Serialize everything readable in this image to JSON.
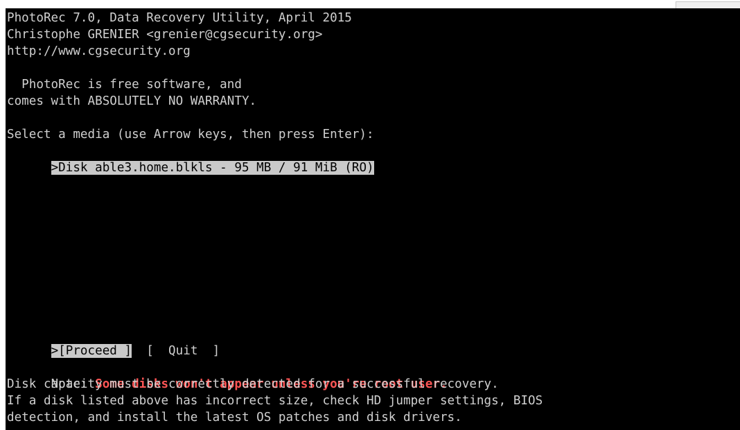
{
  "header": {
    "line1": "PhotoRec 7.0, Data Recovery Utility, April 2015",
    "line2": "Christophe GRENIER <grenier@cgsecurity.org>",
    "line3": "http://www.cgsecurity.org"
  },
  "license": {
    "line1": "  PhotoRec is free software, and",
    "line2": "comes with ABSOLUTELY NO WARRANTY."
  },
  "media": {
    "prompt": "Select a media (use Arrow keys, then press Enter):",
    "items": [
      ">Disk able3.home.blkls - 95 MB / 91 MiB (RO)"
    ]
  },
  "actions": {
    "proceed": ">[Proceed ]",
    "quit": "[  Quit  ]"
  },
  "notes": {
    "prefix": "Note: ",
    "warning": "Some disks won't appear unless you're root user.",
    "line2": "Disk capacity must be correctly detected for a successful recovery.",
    "line3": "If a disk listed above has incorrect size, check HD jumper settings, BIOS",
    "line4": "detection, and install the latest OS patches and disk drivers."
  },
  "colors": {
    "background": "#000000",
    "text": "#d0d0d0",
    "highlight_bg": "#c9c9c9",
    "highlight_fg": "#000000",
    "warning": "#ff5555"
  }
}
